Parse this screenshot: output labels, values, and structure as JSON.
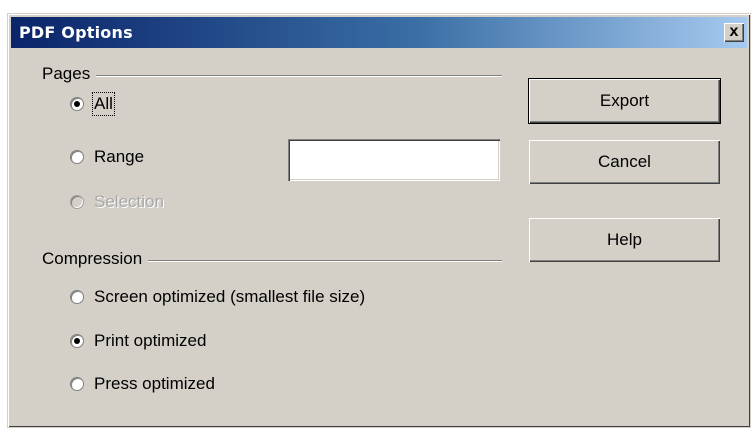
{
  "window": {
    "title": "PDF Options",
    "close_label": "x"
  },
  "pages_group": {
    "title": "Pages",
    "options": [
      {
        "label": "All",
        "checked": true,
        "disabled": false
      },
      {
        "label": "Range",
        "checked": false,
        "disabled": false
      },
      {
        "label": "Selection",
        "checked": false,
        "disabled": true
      }
    ],
    "range_value": ""
  },
  "compression_group": {
    "title": "Compression",
    "options": [
      {
        "label": "Screen optimized (smallest file size)",
        "checked": false
      },
      {
        "label": "Print optimized",
        "checked": true
      },
      {
        "label": "Press optimized",
        "checked": false
      }
    ]
  },
  "buttons": {
    "export": "Export",
    "cancel": "Cancel",
    "help": "Help"
  }
}
